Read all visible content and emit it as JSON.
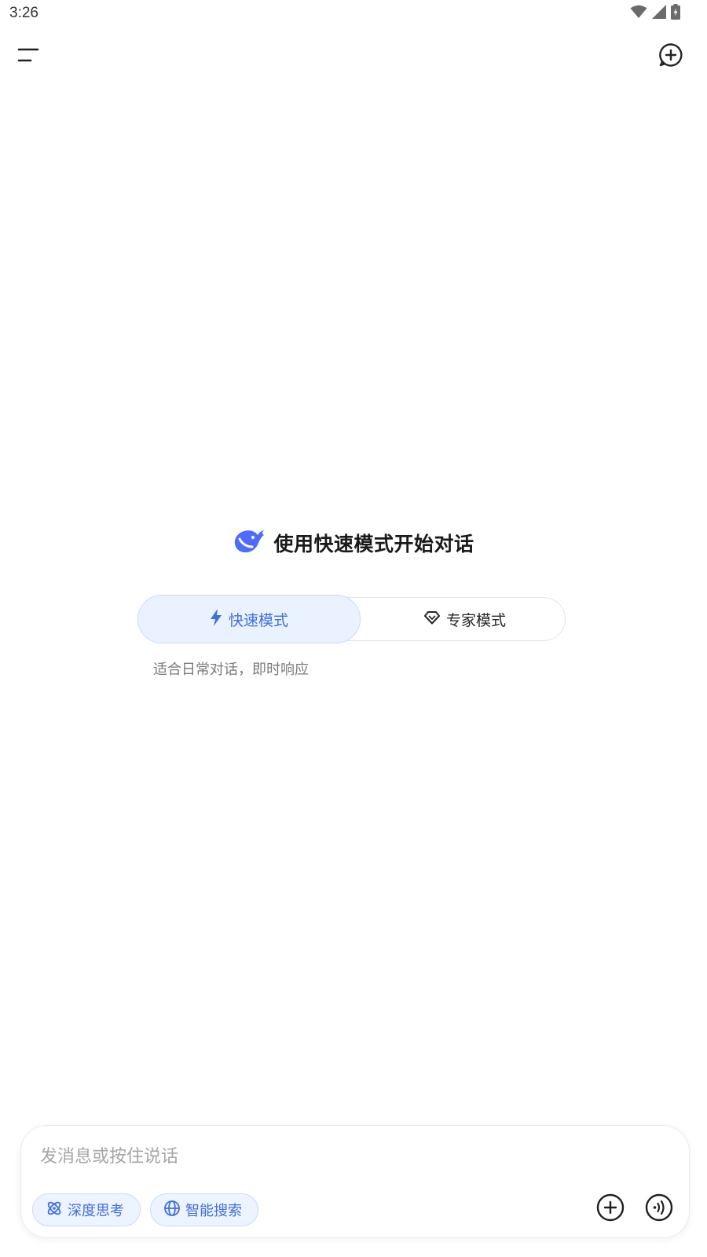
{
  "status_bar": {
    "time": "3:26"
  },
  "top_bar": {
    "menu_icon": "menu-icon",
    "new_chat_icon": "new-chat-icon"
  },
  "welcome": {
    "title": "使用快速模式开始对话"
  },
  "modes": {
    "fast_label": "快速模式",
    "expert_label": "专家模式",
    "selected": "fast",
    "description": "适合日常对话，即时响应"
  },
  "composer": {
    "placeholder": "发消息或按住说话",
    "value": "",
    "deep_think_label": "深度思考",
    "smart_search_label": "智能搜索"
  },
  "colors": {
    "accent": "#3f6fe0",
    "accent_bg": "#eaf1ff",
    "text": "#1a1a1a",
    "muted": "#7a7a7a"
  }
}
